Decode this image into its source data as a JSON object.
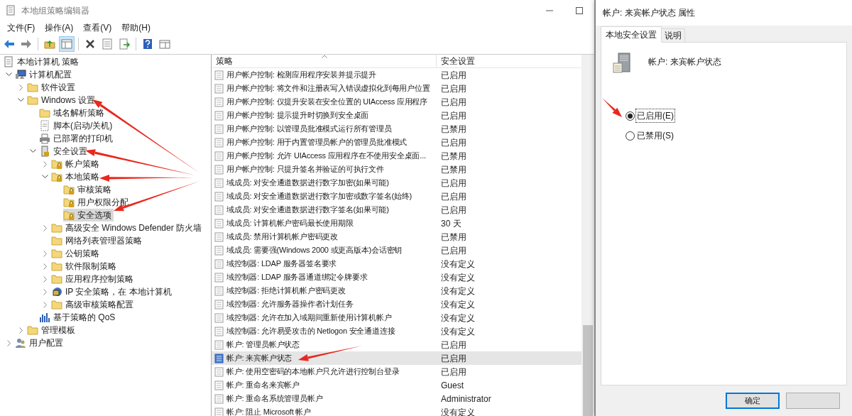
{
  "window": {
    "title": "本地组策略编辑器"
  },
  "menu": [
    "文件(F)",
    "操作(A)",
    "查看(V)",
    "帮助(H)"
  ],
  "toolbar": [
    {
      "kind": "back",
      "pressed": false
    },
    {
      "kind": "forward",
      "pressed": false
    },
    {
      "kind": "up",
      "pressed": false
    },
    {
      "kind": "tree",
      "pressed": true
    },
    {
      "kind": "delete",
      "pressed": false
    },
    {
      "kind": "properties",
      "pressed": false
    },
    {
      "kind": "export",
      "pressed": false
    },
    {
      "kind": "help",
      "pressed": false
    },
    {
      "kind": "view",
      "pressed": false
    }
  ],
  "tree": [
    {
      "label": "本地计算机 策略",
      "kind": "policy",
      "selected": false,
      "children": [
        {
          "label": "计算机配置",
          "kind": "computer",
          "expanded": true,
          "selected": false,
          "children": [
            {
              "label": "软件设置",
              "kind": "folder",
              "expanded": false,
              "selected": false
            },
            {
              "label": "Windows 设置",
              "kind": "folder",
              "expanded": true,
              "selected": false,
              "children": [
                {
                  "label": "域名解析策略",
                  "kind": "folder",
                  "selected": false
                },
                {
                  "label": "脚本(启动/关机)",
                  "kind": "script",
                  "selected": false
                },
                {
                  "label": "已部署的打印机",
                  "kind": "printer",
                  "selected": false
                },
                {
                  "label": "安全设置",
                  "kind": "security",
                  "expanded": true,
                  "selected": false,
                  "children": [
                    {
                      "label": "帐户策略",
                      "kind": "locked",
                      "expanded": false,
                      "selected": false
                    },
                    {
                      "label": "本地策略",
                      "kind": "locked",
                      "expanded": true,
                      "selected": false,
                      "children": [
                        {
                          "label": "审核策略",
                          "kind": "locked",
                          "selected": false
                        },
                        {
                          "label": "用户权限分配",
                          "kind": "locked",
                          "selected": false
                        },
                        {
                          "label": "安全选项",
                          "kind": "locked",
                          "selected": true
                        }
                      ]
                    },
                    {
                      "label": "高级安全 Windows Defender 防火墙",
                      "kind": "folder",
                      "expanded": false,
                      "selected": false
                    },
                    {
                      "label": "网络列表管理器策略",
                      "kind": "folder",
                      "selected": false
                    },
                    {
                      "label": "公钥策略",
                      "kind": "folder",
                      "expanded": false,
                      "selected": false
                    },
                    {
                      "label": "软件限制策略",
                      "kind": "folder",
                      "expanded": false,
                      "selected": false
                    },
                    {
                      "label": "应用程序控制策略",
                      "kind": "folder",
                      "expanded": false,
                      "selected": false
                    },
                    {
                      "label": "IP 安全策略，在 本地计算机",
                      "kind": "ip",
                      "expanded": false,
                      "selected": false
                    },
                    {
                      "label": "高级审核策略配置",
                      "kind": "folder",
                      "expanded": false,
                      "selected": false
                    }
                  ]
                },
                {
                  "label": "基于策略的 QoS",
                  "kind": "chart",
                  "selected": false
                }
              ]
            },
            {
              "label": "管理模板",
              "kind": "folder",
              "expanded": false,
              "selected": false
            }
          ]
        },
        {
          "label": "用户配置",
          "kind": "user",
          "expanded": false,
          "selected": false
        }
      ]
    }
  ],
  "table": {
    "columns": [
      "策略",
      "安全设置"
    ],
    "rows": [
      {
        "policy": "用户帐户控制: 检测应用程序安装并提示提升",
        "setting": "已启用",
        "selected": false
      },
      {
        "policy": "用户帐户控制: 将文件和注册表写入错误虚拟化到每用户位置",
        "setting": "已启用",
        "selected": false
      },
      {
        "policy": "用户帐户控制: 仅提升安装在安全位置的 UIAccess 应用程序",
        "setting": "已启用",
        "selected": false
      },
      {
        "policy": "用户帐户控制: 提示提升时切换到安全桌面",
        "setting": "已启用",
        "selected": false
      },
      {
        "policy": "用户帐户控制: 以管理员批准模式运行所有管理员",
        "setting": "已禁用",
        "selected": false
      },
      {
        "policy": "用户帐户控制: 用于内置管理员帐户的管理员批准模式",
        "setting": "已启用",
        "selected": false
      },
      {
        "policy": "用户帐户控制: 允许 UIAccess 应用程序在不使用安全桌面...",
        "setting": "已禁用",
        "selected": false
      },
      {
        "policy": "用户帐户控制: 只提升签名并验证的可执行文件",
        "setting": "已禁用",
        "selected": false
      },
      {
        "policy": "域成员: 对安全通道数据进行数字加密(如果可能)",
        "setting": "已启用",
        "selected": false
      },
      {
        "policy": "域成员: 对安全通道数据进行数字加密或数字签名(始终)",
        "setting": "已启用",
        "selected": false
      },
      {
        "policy": "域成员: 对安全通道数据进行数字签名(如果可能)",
        "setting": "已启用",
        "selected": false
      },
      {
        "policy": "域成员: 计算机帐户密码最长使用期限",
        "setting": "30 天",
        "selected": false
      },
      {
        "policy": "域成员: 禁用计算机帐户密码更改",
        "setting": "已禁用",
        "selected": false
      },
      {
        "policy": "域成员: 需要强(Windows 2000 或更高版本)会话密钥",
        "setting": "已启用",
        "selected": false
      },
      {
        "policy": "域控制器: LDAP 服务器签名要求",
        "setting": "没有定义",
        "selected": false
      },
      {
        "policy": "域控制器: LDAP 服务器通道绑定令牌要求",
        "setting": "没有定义",
        "selected": false
      },
      {
        "policy": "域控制器: 拒绝计算机帐户密码更改",
        "setting": "没有定义",
        "selected": false
      },
      {
        "policy": "域控制器: 允许服务器操作者计划任务",
        "setting": "没有定义",
        "selected": false
      },
      {
        "policy": "域控制器:  允许在加入域期间重新使用计算机帐户",
        "setting": "没有定义",
        "selected": false
      },
      {
        "policy": "域控制器: 允许易受攻击的 Netlogon 安全通道连接",
        "setting": "没有定义",
        "selected": false
      },
      {
        "policy": "帐户: 管理员帐户状态",
        "setting": "已启用",
        "selected": false
      },
      {
        "policy": "帐户: 来宾帐户状态",
        "setting": "已启用",
        "selected": true
      },
      {
        "policy": "帐户: 使用空密码的本地帐户只允许进行控制台登录",
        "setting": "已启用",
        "selected": false
      },
      {
        "policy": "帐户: 重命名来宾帐户",
        "setting": "Guest",
        "selected": false
      },
      {
        "policy": "帐户: 重命名系统管理员帐户",
        "setting": "Administrator",
        "selected": false
      },
      {
        "policy": "帐户: 阻止 Microsoft 帐户",
        "setting": "没有定义",
        "selected": false
      }
    ]
  },
  "dialog": {
    "title": "帐户: 来宾帐户状态 属性",
    "tabs": [
      {
        "label": "本地安全设置",
        "selected": true
      },
      {
        "label": "说明",
        "selected": false
      }
    ],
    "policy_name": "帐户: 来宾帐户状态",
    "options": [
      {
        "label": "已启用(E)",
        "selected": true
      },
      {
        "label": "已禁用(S)",
        "selected": false
      }
    ],
    "buttons": [
      {
        "label": "确定",
        "default": true
      },
      {
        "default": false
      }
    ]
  }
}
